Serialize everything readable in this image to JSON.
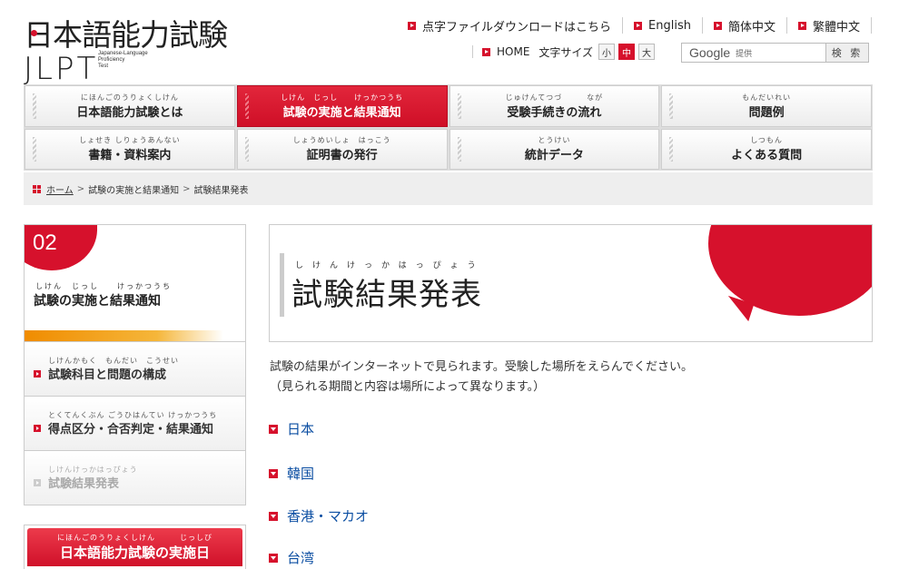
{
  "logo": {
    "title": "日本語能力試験",
    "abbr": "JLPT",
    "sub": [
      "Japanese-Language",
      "Proficiency",
      "Test"
    ]
  },
  "toplinks": [
    {
      "label": "点字ファイルダウンロードはこちら"
    },
    {
      "label": "English"
    },
    {
      "label": "簡体中文"
    },
    {
      "label": "繁體中文"
    }
  ],
  "utility": {
    "home": "HOME",
    "font_size_label": "文字サイズ",
    "sizes": [
      "小",
      "中",
      "大"
    ],
    "search_brand": "Google",
    "search_sub": "提供",
    "search_button": "検 索"
  },
  "gnav": [
    {
      "ruby": "にほんごのうりょくしけん",
      "label": "日本語能力試験とは"
    },
    {
      "ruby": "しけん　じっし　　けっかつうち",
      "label": "試験の実施と結果通知"
    },
    {
      "ruby": "じゅけんてつづ　　　なが",
      "label": "受験手続きの流れ"
    },
    {
      "ruby": "もんだいれい",
      "label": "問題例"
    },
    {
      "ruby": "しょせき しりょうあんない",
      "label": "書籍・資料案内"
    },
    {
      "ruby": "しょうめいしょ　はっこう",
      "label": "証明書の発行"
    },
    {
      "ruby": "とうけい",
      "label": "統計データ"
    },
    {
      "ruby": "しつもん",
      "label": "よくある質問"
    }
  ],
  "breadcrumb": {
    "home": "ホーム",
    "sep": ">",
    "parent": "試験の実施と結果通知",
    "current": "試験結果発表"
  },
  "sidebar": {
    "number": "02",
    "ruby": "しけん　じっし　　けっかつうち",
    "title": "試験の実施と結果通知",
    "items": [
      {
        "ruby": "しけんかもく　もんだい　こうせい",
        "label": "試験科目と問題の構成"
      },
      {
        "ruby": "とくてんくぶん ごうひはんてい けっかつうち",
        "label": "得点区分・合否判定・結果通知"
      },
      {
        "ruby": "しけんけっかはっぴょう",
        "label": "試験結果発表"
      }
    ],
    "banner": {
      "ruby": "にほんごのうりょくしけん　　　じっしび",
      "label": "日本語能力試験の実施日"
    }
  },
  "main": {
    "ruby": "しけんけっかはっぴょう",
    "title": "試験結果発表",
    "intro": [
      "試験の結果がインターネットで見られます。受験した場所をえらんでください。",
      "（見られる期間と内容は場所によって異なります。）"
    ],
    "regions": [
      "日本",
      "韓国",
      "香港・マカオ",
      "台湾"
    ]
  },
  "colors": {
    "accent": "#d6112c",
    "link": "#0b4ea2",
    "orange": "#f08c00"
  }
}
